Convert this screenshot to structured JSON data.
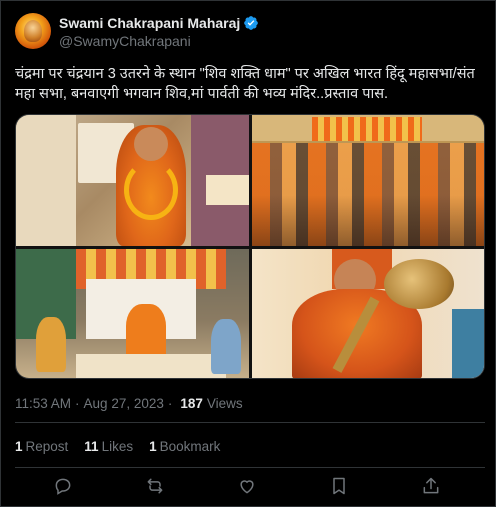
{
  "tweet": {
    "display_name": "Swami Chakrapani Maharaj",
    "handle": "@SwamyChakrapani",
    "text": "चंद्रमा पर चंद्रयान 3 उतरने के स्थान \"शिव शक्ति धाम\" पर अखिल भारत हिंदू महासभा/संत महा सभा, बनवाएगी भगवान शिव,मां पार्वती की भव्य मंदिर..प्रस्ताव पास.",
    "time": "11:53 AM",
    "date": "Aug 27, 2023",
    "views_count": "187",
    "views_label": "Views",
    "separator": "·"
  },
  "stats": {
    "reposts_count": "1",
    "reposts_label": "Repost",
    "likes_count": "11",
    "likes_label": "Likes",
    "bookmarks_count": "1",
    "bookmarks_label": "Bookmark"
  },
  "icons": {
    "verified": "verified-badge-icon",
    "reply": "reply-icon",
    "repost": "repost-icon",
    "like": "heart-icon",
    "bookmark": "bookmark-icon",
    "share": "share-icon"
  },
  "colors": {
    "background": "#000000",
    "text": "#e7e9ea",
    "secondary": "#71767b",
    "border": "#2f3336",
    "verified": "#1d9bf0"
  }
}
